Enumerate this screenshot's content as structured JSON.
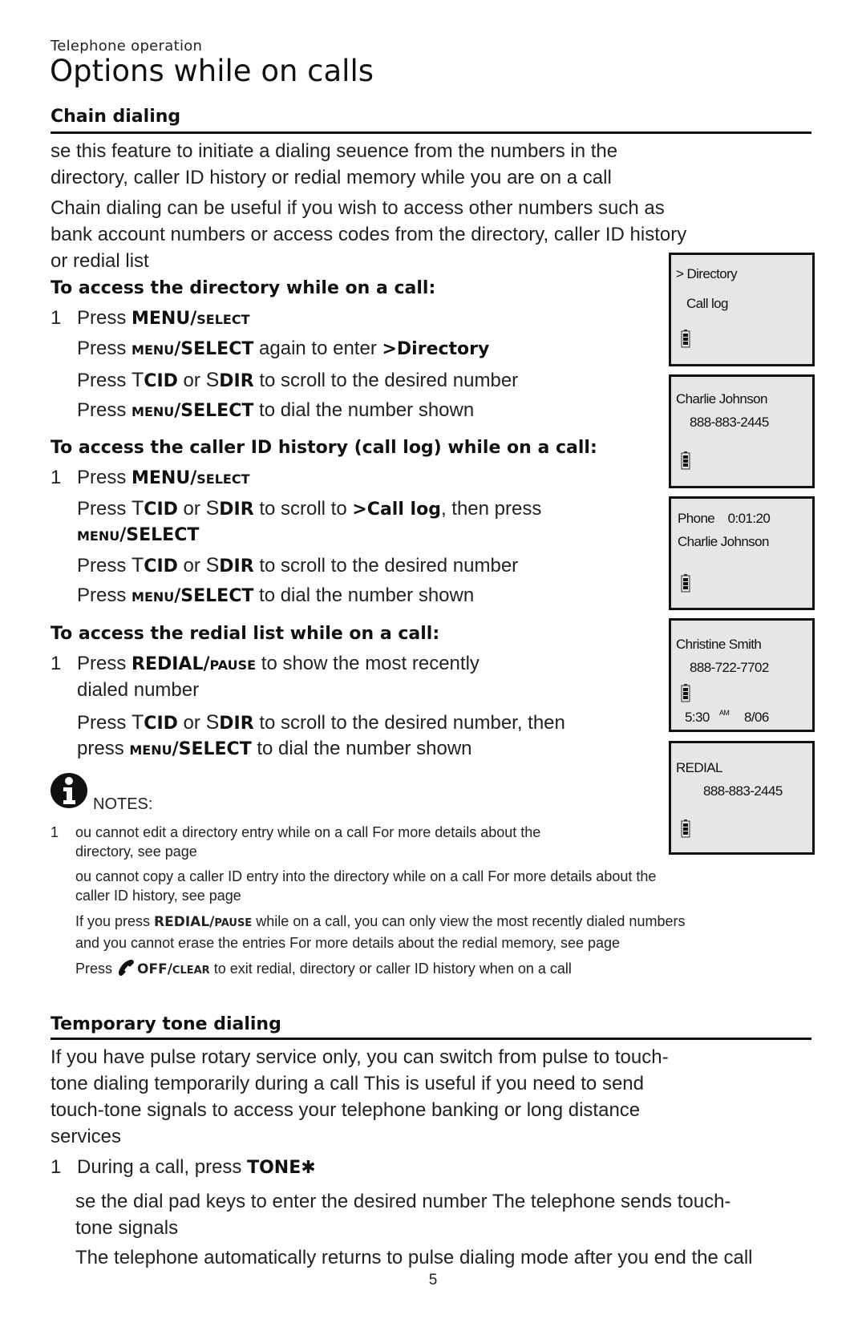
{
  "header": {
    "section": "Telephone operation",
    "title": "Options while on calls"
  },
  "chain_dialing": {
    "heading": "Chain dialing",
    "intro_lines": [
      "se this feature to initiate a dialing seuence from the numbers in the",
      "directory, caller ID history or redial memory while you are on a call"
    ],
    "useful_lines": [
      "Chain dialing can be useful if you wish to access other numbers such as",
      "bank account  numbers or access codes from the directory, caller ID history",
      "or redial list"
    ],
    "directory": {
      "heading": "To access the directory while on a call:",
      "steps": [
        {
          "num": "1",
          "pre": "Press ",
          "key1": "MENU/",
          "key1_sc": "SELECT",
          "post": ""
        },
        {
          "num": "",
          "pre": "Press ",
          "key_sc": "MENU",
          "key": "/SELECT",
          "mid": " again to enter  ",
          "target": ">Directory"
        },
        {
          "num": "",
          "pre": "Press  ",
          "k1": "T",
          "k1b": "CID",
          "or": " or  ",
          "k2": "S",
          "k2b": "DIR",
          "post": " to scroll to the desired number"
        },
        {
          "num": "",
          "pre": "Press ",
          "key_sc": "MENU",
          "key": "/SELECT",
          "post": " to dial  the number shown"
        }
      ]
    },
    "call_log": {
      "heading": "To access the caller ID history (call log) while on a call:",
      "steps": [
        {
          "num": "1",
          "pre": "Press ",
          "key1": "MENU/",
          "key1_sc": "SELECT"
        },
        {
          "num": "",
          "pre": "Press  ",
          "k1": "T",
          "k1b": "CID",
          "or": " or  ",
          "k2": "S",
          "k2b": "DIR",
          "mid": " to scroll to  ",
          "target": ">Call log",
          "post": ", then press"
        },
        {
          "num": "",
          "key_sc": "MENU",
          "key": "/SELECT"
        },
        {
          "num": "",
          "pre": "Press  ",
          "k1": "T",
          "k1b": "CID",
          "or": " or  ",
          "k2": "S",
          "k2b": "DIR",
          "post": " to scroll to the desired number"
        },
        {
          "num": "",
          "pre": "Press ",
          "key_sc": "MENU",
          "key": "/SELECT",
          "post": " to dial the number   shown"
        }
      ]
    },
    "redial": {
      "heading": "To access the redial list while on a call:",
      "steps": [
        {
          "num": "1",
          "pre": "Press ",
          "key1": "REDIAL/",
          "key1_sc": "PAUSE",
          "post": " to show the most recently"
        },
        {
          "num": "",
          "pre": "dialed number"
        },
        {
          "num": "",
          "pre": "Press  ",
          "k1": "T",
          "k1b": "CID",
          "or": " or  ",
          "k2": "S",
          "k2b": "DIR",
          "post": " to scroll to the desired number, then"
        },
        {
          "num": "",
          "pre": "press ",
          "key_sc": "MENU",
          "key": "/SELECT",
          "post": " to dial the number shown"
        }
      ]
    }
  },
  "notes": {
    "label": "NOTES:",
    "items": [
      {
        "num": "1",
        "lines": [
          "ou cannot edit a directory entry while on a call For more details about the",
          "directory, see   page"
        ]
      },
      {
        "num": "",
        "lines": [
          "ou cannot copy a caller ID entry into the directory while on a call For more details about the",
          "caller ID history, see   page"
        ]
      },
      {
        "num": "",
        "pre": "If you press  ",
        "key": "REDIAL/",
        "key_sc": "PAUSE",
        "post": " while on a call, you can only view the  most recently dialed numbers",
        "line2": "and you cannot erase the entries For more details about the redial memory, see        page"
      },
      {
        "num": "",
        "pre": "Press ",
        "key": "OFF/",
        "key_sc": "CLEAR",
        "post": " to exit redial, directory or caller ID history when on a call"
      }
    ]
  },
  "lcd_screens": [
    {
      "lines": [
        "> Directory",
        "Call log"
      ],
      "battery": "full"
    },
    {
      "lines": [
        "Charlie Johnson",
        "888-883-2445"
      ],
      "battery": "full"
    },
    {
      "lines": [
        "Phone    0:01:20",
        "Charlie Johnson"
      ],
      "battery": "full"
    },
    {
      "lines": [
        "Christine Smith",
        "888-722-7702"
      ],
      "time": "5:30",
      "ampm": "AM",
      "date": "8/06",
      "battery": "full"
    },
    {
      "lines": [
        "REDIAL",
        "888-883-2445"
      ],
      "battery": "full"
    }
  ],
  "tone_dialing": {
    "heading": "Temporary tone dialing",
    "intro_lines": [
      "If you have pulse rotary service only, you can switch from pulse to touch-",
      "tone dialing temporarily during a call This is useful if you need to send",
      "touch-tone signals to access your telephone banking or long distance",
      "services"
    ],
    "steps": [
      {
        "num": "1",
        "pre": "During a call, press   ",
        "key": "TONE",
        "glyph": "✱"
      },
      {
        "num": "",
        "lines": [
          "se the dial pad keys to enter the desired number The telephone sends touch-",
          "tone signals"
        ]
      },
      {
        "num": "",
        "lines": [
          "The telephone automatically returns to pulse dialing mode after you end the call"
        ]
      }
    ]
  },
  "footer": {
    "page_number": "5"
  }
}
